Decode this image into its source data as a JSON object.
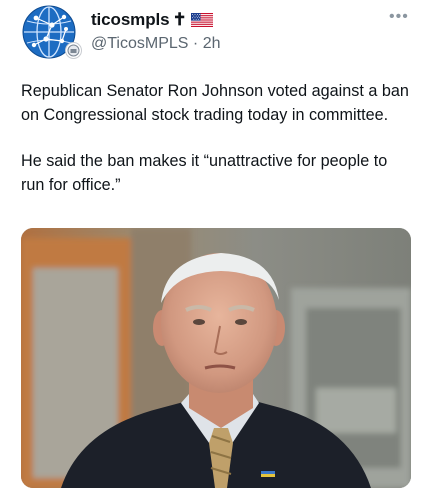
{
  "post": {
    "author": {
      "display_name": "ticosmpls",
      "name_suffix": "✝",
      "flag_icon": "us-flag-icon",
      "handle": "@TicosMPLS",
      "separator": "·",
      "time_ago": "2h"
    },
    "more_button_icon": "more-options-icon",
    "text": {
      "paragraph_1": "Republican Senator Ron Johnson voted against a ban on Congressional stock trading today in committee.",
      "paragraph_2": "He said the ban makes it “unattractive for people to run for office.”"
    },
    "media": {
      "type": "photo",
      "subject": "man in dark suit with striped tie and lapel pin, blurred building background"
    }
  },
  "colors": {
    "text_primary": "#0f1419",
    "text_secondary": "#5b6670",
    "avatar_blue": "#1a66b8",
    "background": "#ffffff"
  }
}
